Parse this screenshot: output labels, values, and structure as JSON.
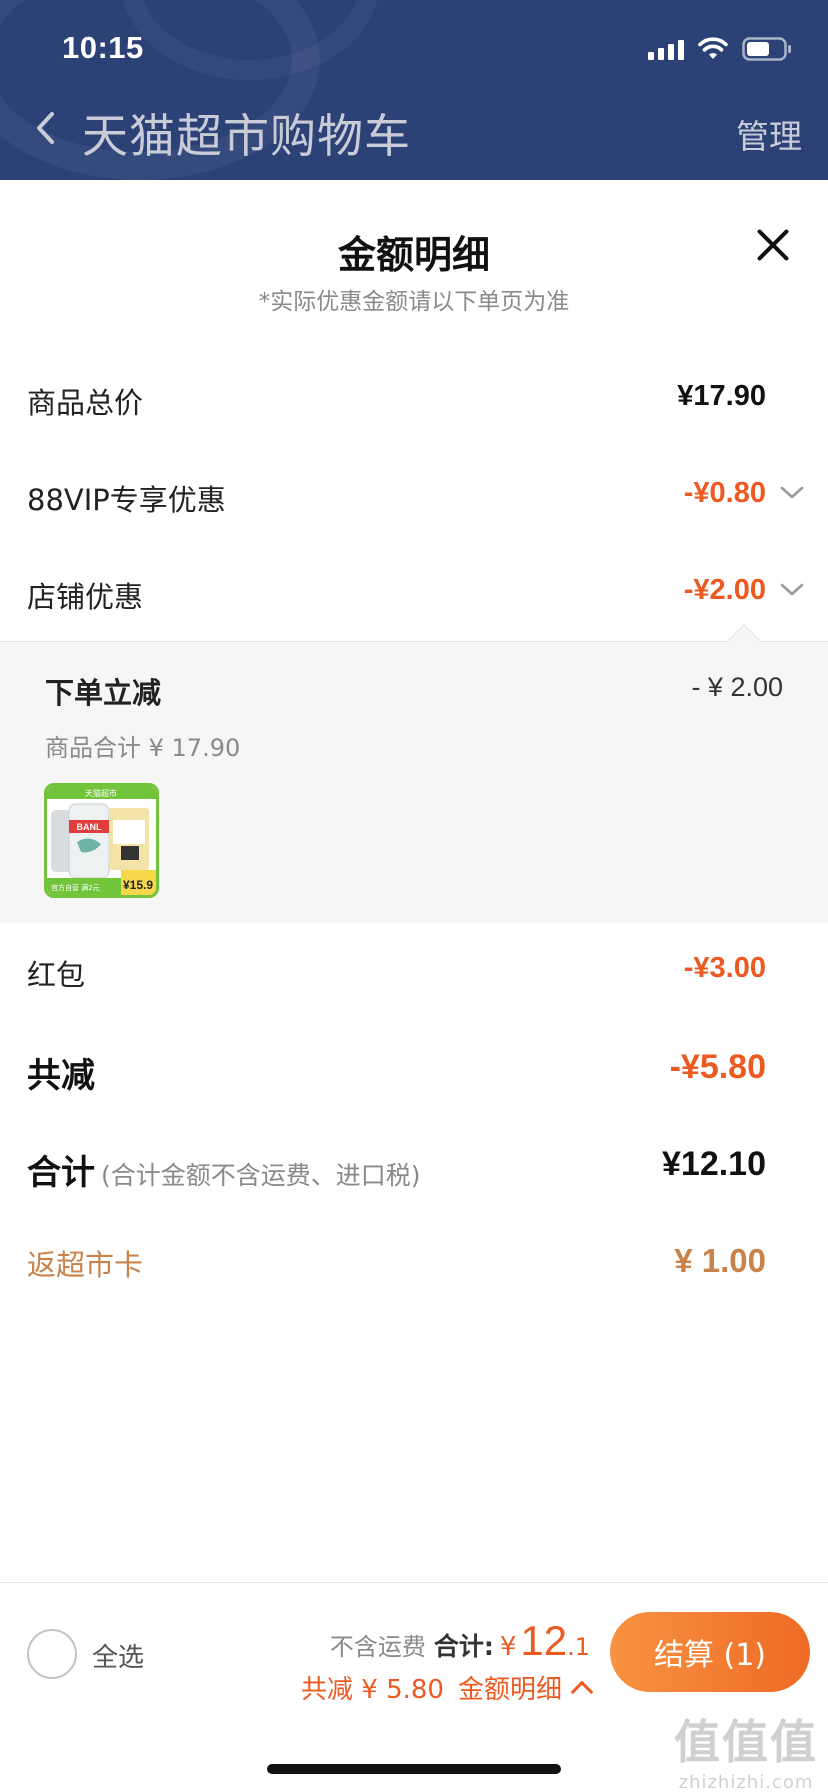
{
  "status_bar": {
    "time": "10:15"
  },
  "nav": {
    "title": "天猫超市购物车",
    "manage": "管理"
  },
  "sheet": {
    "title": "金额明细",
    "subtitle": "*实际优惠金额请以下单页为准"
  },
  "rows": {
    "subtotal": {
      "label": "商品总价",
      "value": "¥17.90"
    },
    "vip": {
      "label": "88VIP专享优惠",
      "value": "-¥0.80"
    },
    "store": {
      "label": "店铺优惠",
      "value": "-¥2.00"
    },
    "redpacket": {
      "label": "红包",
      "value": "-¥3.00"
    },
    "total_discount": {
      "label": "共减",
      "value": "-¥5.80"
    },
    "total": {
      "label": "合计",
      "note": "(合计金额不含运费、进口税)",
      "value": "¥12.10"
    },
    "card": {
      "label": "返超市卡",
      "value": "¥ 1.00"
    }
  },
  "store_detail": {
    "title": "下单立减",
    "amount": "- ¥ 2.00",
    "sub": "商品合计 ¥ 17.90",
    "product_thumb": {
      "banner": "天猫超市",
      "brand": "BANL",
      "footer": "官方自营 满2元",
      "price": "¥15.9"
    }
  },
  "bottom_bar": {
    "select_all": "全选",
    "exclude_shipping": "不含运费",
    "total_label": "合计:",
    "currency": "¥",
    "total_int": "12",
    "total_dec": ".1",
    "saved": "共减 ¥ 5.80",
    "detail_link": "金额明细",
    "checkout": "结算 (1)"
  },
  "watermark": {
    "big": "值值值",
    "small": "zhizhizhi.com"
  },
  "colors": {
    "header_bg": "#2c4276",
    "discount_red": "#ec5a22",
    "card_gold": "#c8824a",
    "checkout_gradient": [
      "#f79342",
      "#ef6a24"
    ]
  }
}
